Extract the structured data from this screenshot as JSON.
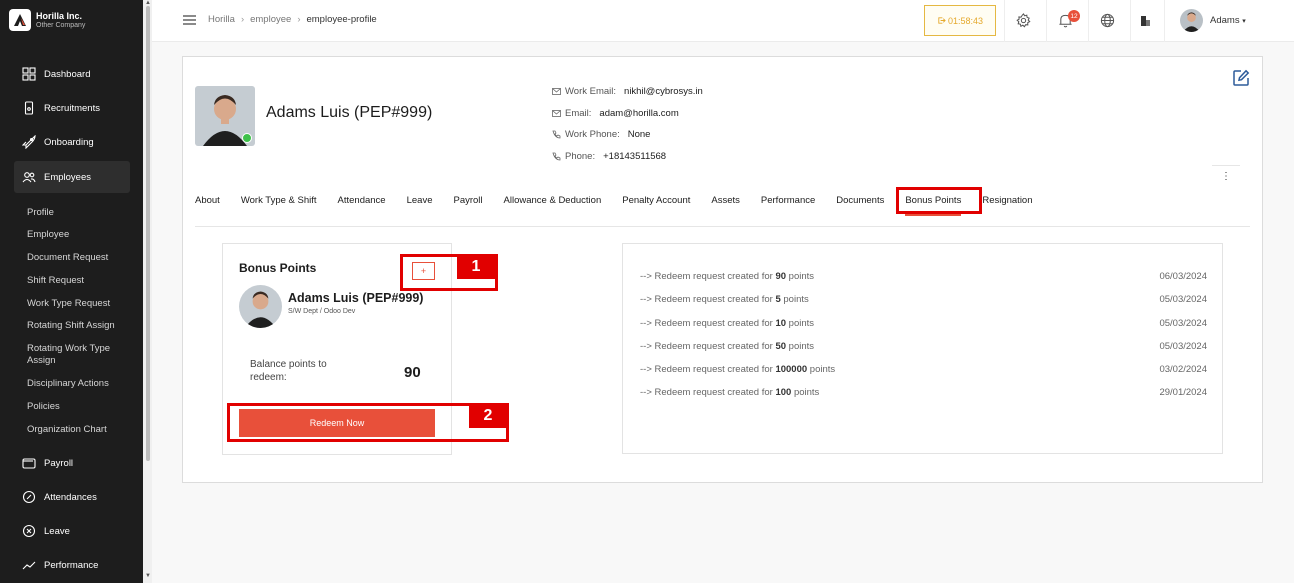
{
  "brand": {
    "name": "Horilla Inc.",
    "subtitle": "Other Company"
  },
  "sidebar": {
    "main_items": [
      {
        "label": "Dashboard",
        "icon": "grid-icon"
      },
      {
        "label": "Recruitments",
        "icon": "phone-icon"
      },
      {
        "label": "Onboarding",
        "icon": "rocket-icon"
      },
      {
        "label": "Employees",
        "icon": "people-icon"
      }
    ],
    "sub_items": [
      "Profile",
      "Employee",
      "Document Request",
      "Shift Request",
      "Work Type Request",
      "Rotating Shift Assign",
      "Rotating Work Type Assign",
      "Disciplinary Actions",
      "Policies",
      "Organization Chart"
    ],
    "bottom_items": [
      {
        "label": "Payroll",
        "icon": "wallet-icon"
      },
      {
        "label": "Attendances",
        "icon": "clock-icon"
      },
      {
        "label": "Leave",
        "icon": "x-circle-icon"
      },
      {
        "label": "Performance",
        "icon": "trend-icon"
      }
    ]
  },
  "header": {
    "breadcrumb": [
      "Horilla",
      "employee",
      "employee-profile"
    ],
    "timer": "01:58:43",
    "notification_count": "12",
    "user_name": "Adams"
  },
  "profile": {
    "name": "Adams Luis (PEP#999)",
    "contacts": [
      {
        "label": "Work Email:",
        "value": "nikhil@cybrosys.in",
        "icon": "mail-icon"
      },
      {
        "label": "Email:",
        "value": "adam@horilla.com",
        "icon": "mail-icon"
      },
      {
        "label": "Work Phone:",
        "value": "None",
        "icon": "phone-icon"
      },
      {
        "label": "Phone:",
        "value": "+18143511568",
        "icon": "phone-icon"
      }
    ],
    "kebab": "⋮"
  },
  "tabs": [
    "About",
    "Work Type & Shift",
    "Attendance",
    "Leave",
    "Payroll",
    "Allowance & Deduction",
    "Penalty Account",
    "Assets",
    "Performance",
    "Documents",
    "Bonus Points",
    "Resignation"
  ],
  "active_tab": "Bonus Points",
  "bonus_points": {
    "title": "Bonus Points",
    "add_label": "+",
    "employee_name": "Adams Luis (PEP#999)",
    "department": "S/W Dept / Odoo Dev",
    "balance_label": "Balance points to redeem:",
    "balance_value": "90",
    "redeem_label": "Redeem Now"
  },
  "history": [
    {
      "prefix": "--> Redeem request created for",
      "points": "90",
      "suffix": "points",
      "date": "06/03/2024"
    },
    {
      "prefix": "--> Redeem request created for",
      "points": "5",
      "suffix": "points",
      "date": "05/03/2024"
    },
    {
      "prefix": "--> Redeem request created for",
      "points": "10",
      "suffix": "points",
      "date": "05/03/2024"
    },
    {
      "prefix": "--> Redeem request created for",
      "points": "50",
      "suffix": "points",
      "date": "05/03/2024"
    },
    {
      "prefix": "--> Redeem request created for",
      "points": "100000",
      "suffix": "points",
      "date": "03/02/2024"
    },
    {
      "prefix": "--> Redeem request created for",
      "points": "100",
      "suffix": "points",
      "date": "29/01/2024"
    }
  ],
  "callouts": [
    "1",
    "2"
  ],
  "colors": {
    "accent": "#e8503a",
    "callout": "#e10000",
    "sidebar": "#1d1d1d",
    "timer": "#e5a92d"
  }
}
